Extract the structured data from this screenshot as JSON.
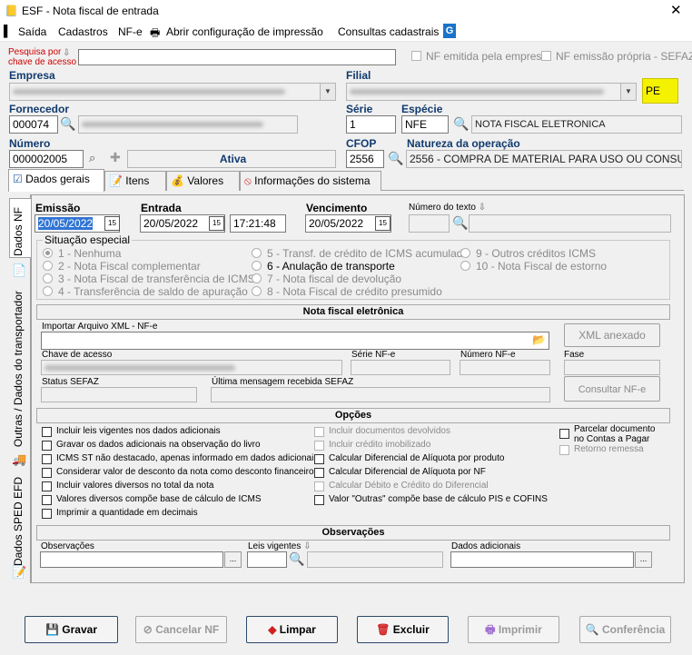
{
  "window": {
    "app": "ESF",
    "separator": "-",
    "title": "Nota fiscal de entrada",
    "close": "✕"
  },
  "menu": {
    "saida": "Saída",
    "cadastros": "Cadastros",
    "nfe": "NF-e",
    "config": "Abrir configuração de impressão",
    "consultas": "Consultas cadastrais"
  },
  "header": {
    "pesquisa_label": "Pesquisa por chave de acesso",
    "pesquisa_label_1": "Pesquisa por",
    "pesquisa_label_2": "chave de acesso",
    "nf_emitida": "NF emitida pela empresa",
    "nf_propria": "NF emissão própria - SEFAZ",
    "empresa_label": "Empresa",
    "filial_label": "Filial",
    "uf": "PE",
    "fornecedor_label": "Fornecedor",
    "fornecedor_code": "000074",
    "serie_label": "Série",
    "serie": "1",
    "especie_label": "Espécie",
    "especie": "NFE",
    "especie_desc": "NOTA FISCAL ELETRONICA",
    "numero_label": "Número",
    "numero": "000002005",
    "status": "Ativa",
    "cfop_label": "CFOP",
    "cfop": "2556",
    "natureza_label": "Natureza da operação",
    "natureza": "2556 - COMPRA DE MATERIAL PARA USO OU CONSUMO"
  },
  "tabs": {
    "dados_gerais": "Dados gerais",
    "itens": "Itens",
    "valores": "Valores",
    "info": "Informações do sistema"
  },
  "side_tabs": {
    "dados_nf": "Dados NF",
    "transportador": "Outras / Dados do transportador",
    "sped": "Dados SPED EFD"
  },
  "dates": {
    "emissao_label": "Emissão",
    "emissao": "20/05/2022",
    "entrada_label": "Entrada",
    "entrada": "20/05/2022",
    "hora": "17:21:48",
    "vencimento_label": "Vencimento",
    "vencimento": "20/05/2022",
    "numero_texto_label": "Número do texto"
  },
  "situacao": {
    "legend": "Situação especial",
    "options": [
      "1 - Nenhuma",
      "2 - Nota Fiscal complementar",
      "3 - Nota Fiscal de transferência de ICMS",
      "4 - Transferência de saldo de apuração",
      "5 - Transf. de crédito de ICMS acumulado",
      "6 - Anulação de transporte",
      "7 - Nota fiscal de devolução",
      "8 - Nota Fiscal de crédito presumido",
      "9 - Outros créditos ICMS",
      "10 - Nota Fiscal de estorno"
    ]
  },
  "nfe": {
    "title": "Nota fiscal eletrônica",
    "importar_label": "Importar Arquivo XML - NF-e",
    "xml_anexado": "XML anexado",
    "chave_label": "Chave de acesso",
    "serie_label": "Série NF-e",
    "numero_label": "Número NF-e",
    "fase_label": "Fase",
    "status_label": "Status SEFAZ",
    "msg_label": "Última mensagem recebida SEFAZ",
    "consultar": "Consultar NF-e"
  },
  "opcoes": {
    "title": "Opções",
    "col1": [
      "Incluir leis vigentes nos dados adicionais",
      "Gravar os dados adicionais na observação do livro",
      "ICMS ST não destacado, apenas informado em dados adicionais",
      "Considerar valor de desconto da nota como desconto financeiro",
      "Incluir valores diversos no total da nota",
      "Valores diversos compõe base de cálculo de ICMS",
      "Imprimir a quantidade em decimais"
    ],
    "col2": [
      "Incluir documentos devolvidos",
      "Incluir crédito imobilizado",
      "Calcular Diferencial de Alíquota por produto",
      "Calcular Diferencial de Alíquota por NF",
      "Calcular Débito e Crédito do Diferencial",
      "Valor \"Outras\" compõe base de cálculo PIS e COFINS"
    ],
    "parcelar_1": "Parcelar documento",
    "parcelar_2": "no Contas a Pagar",
    "retorno": "Retorno remessa"
  },
  "observacoes": {
    "title": "Observações",
    "obs_label": "Observações",
    "leis_label": "Leis vigentes",
    "dados_label": "Dados adicionais",
    "dots": "..."
  },
  "buttons": {
    "gravar": "Gravar",
    "cancelar": "Cancelar NF",
    "limpar": "Limpar",
    "excluir": "Excluir",
    "imprimir": "Imprimir",
    "conferencia": "Conferência"
  },
  "colors": {
    "label_blue": "#113a6e",
    "uf_highlight": "#f5f200",
    "accent_purple": "#8a40d0"
  }
}
